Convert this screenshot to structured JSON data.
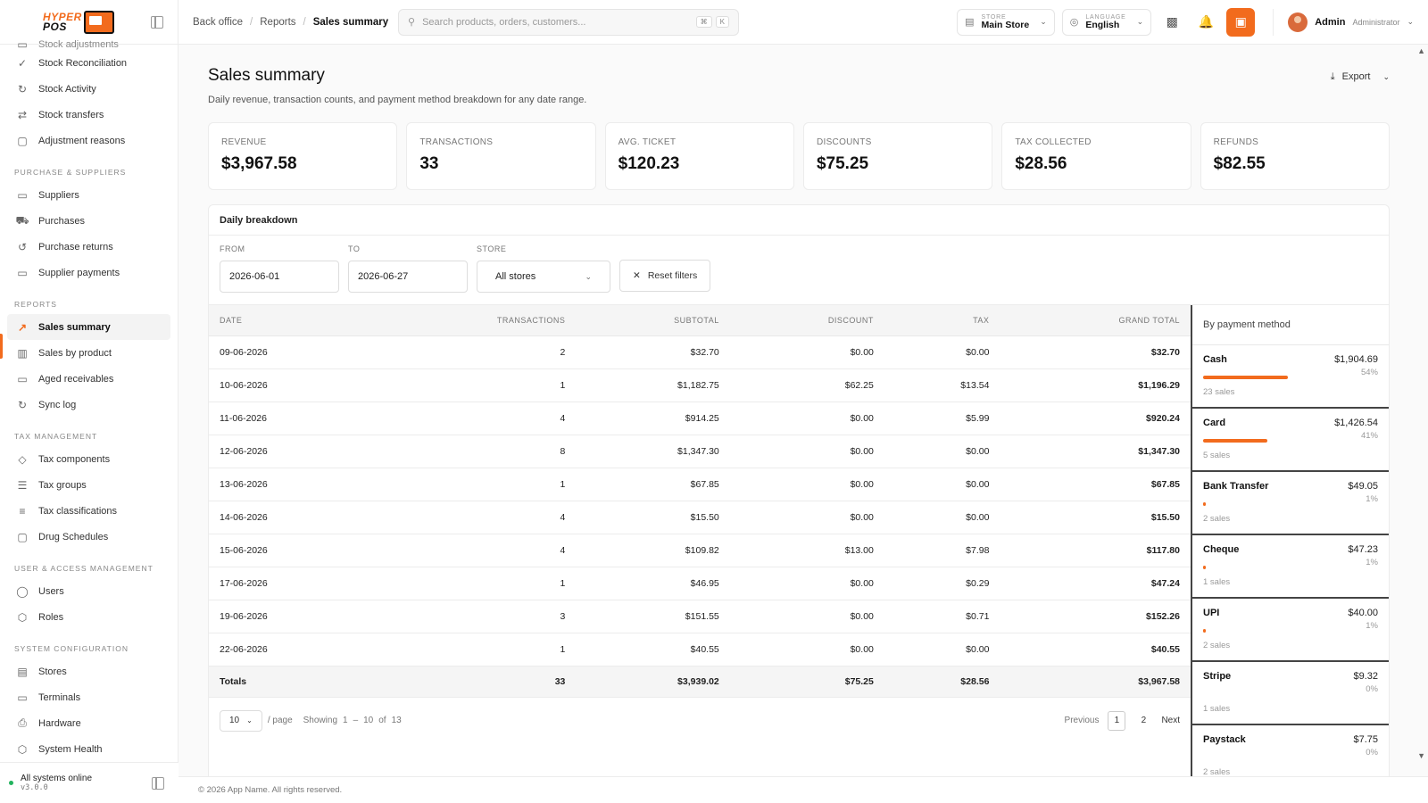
{
  "brand": {
    "line1": "HYPER",
    "line2": "POS"
  },
  "sidebar": {
    "partial_item": "Stock adjustments",
    "items_top": [
      {
        "label": "Stock Reconciliation",
        "icon": "check-icon"
      },
      {
        "label": "Stock Activity",
        "icon": "refresh-icon"
      },
      {
        "label": "Stock transfers",
        "icon": "transfer-icon"
      },
      {
        "label": "Adjustment reasons",
        "icon": "note-icon"
      }
    ],
    "sections": [
      {
        "title": "PURCHASE & SUPPLIERS",
        "items": [
          "Suppliers",
          "Purchases",
          "Purchase returns",
          "Supplier payments"
        ]
      },
      {
        "title": "REPORTS",
        "items": [
          "Sales summary",
          "Sales by product",
          "Aged receivables",
          "Sync log"
        ]
      },
      {
        "title": "TAX MANAGEMENT",
        "items": [
          "Tax components",
          "Tax groups",
          "Tax classifications",
          "Drug Schedules"
        ]
      },
      {
        "title": "USER & ACCESS MANAGEMENT",
        "items": [
          "Users",
          "Roles"
        ]
      },
      {
        "title": "SYSTEM CONFIGURATION",
        "items": [
          "Stores",
          "Terminals",
          "Hardware",
          "System Health"
        ]
      }
    ],
    "status_text": "All systems online",
    "version": "v3.0.0"
  },
  "breadcrumb": {
    "items": [
      "Back office",
      "Reports"
    ],
    "current": "Sales summary"
  },
  "search": {
    "placeholder": "Search products, orders, customers...",
    "kbd1": "⌘",
    "kbd2": "K"
  },
  "store_select": {
    "label": "STORE",
    "value": "Main Store"
  },
  "language_select": {
    "label": "LANGUAGE",
    "value": "English"
  },
  "user": {
    "name": "Admin",
    "role": "Administrator"
  },
  "page": {
    "title": "Sales summary",
    "subtitle": "Daily revenue, transaction counts, and payment method breakdown for any date range.",
    "export_label": "Export"
  },
  "stats": [
    {
      "label": "REVENUE",
      "value": "$3,967.58"
    },
    {
      "label": "TRANSACTIONS",
      "value": "33"
    },
    {
      "label": "AVG. TICKET",
      "value": "$120.23"
    },
    {
      "label": "DISCOUNTS",
      "value": "$75.25"
    },
    {
      "label": "TAX COLLECTED",
      "value": "$28.56"
    },
    {
      "label": "REFUNDS",
      "value": "$82.55"
    }
  ],
  "breakdown": {
    "title": "Daily breakdown",
    "filters": {
      "from_label": "FROM",
      "from_value": "2026-06-01",
      "to_label": "TO",
      "to_value": "2026-06-27",
      "store_label": "STORE",
      "store_value": "All stores",
      "reset_label": "Reset filters"
    },
    "columns": [
      "DATE",
      "TRANSACTIONS",
      "SUBTOTAL",
      "DISCOUNT",
      "TAX",
      "GRAND TOTAL"
    ],
    "rows": [
      [
        "09-06-2026",
        "2",
        "$32.70",
        "$0.00",
        "$0.00",
        "$32.70"
      ],
      [
        "10-06-2026",
        "1",
        "$1,182.75",
        "$62.25",
        "$13.54",
        "$1,196.29"
      ],
      [
        "11-06-2026",
        "4",
        "$914.25",
        "$0.00",
        "$5.99",
        "$920.24"
      ],
      [
        "12-06-2026",
        "8",
        "$1,347.30",
        "$0.00",
        "$0.00",
        "$1,347.30"
      ],
      [
        "13-06-2026",
        "1",
        "$67.85",
        "$0.00",
        "$0.00",
        "$67.85"
      ],
      [
        "14-06-2026",
        "4",
        "$15.50",
        "$0.00",
        "$0.00",
        "$15.50"
      ],
      [
        "15-06-2026",
        "4",
        "$109.82",
        "$13.00",
        "$7.98",
        "$117.80"
      ],
      [
        "17-06-2026",
        "1",
        "$46.95",
        "$0.00",
        "$0.29",
        "$47.24"
      ],
      [
        "19-06-2026",
        "3",
        "$151.55",
        "$0.00",
        "$0.71",
        "$152.26"
      ],
      [
        "22-06-2026",
        "1",
        "$40.55",
        "$0.00",
        "$0.00",
        "$40.55"
      ]
    ],
    "totals": [
      "Totals",
      "33",
      "$3,939.02",
      "$75.25",
      "$28.56",
      "$3,967.58"
    ],
    "pager": {
      "page_size": "10",
      "per_page": "/ page",
      "showing": "Showing",
      "from": "1",
      "dash": "–",
      "to": "10",
      "of": "of",
      "total": "13",
      "previous": "Previous",
      "pages": [
        "1",
        "2"
      ],
      "next": "Next"
    }
  },
  "payments": {
    "title": "By payment method",
    "items": [
      {
        "name": "Cash",
        "amount": "$1,904.69",
        "percent": "54%",
        "share": 0.54,
        "count": "23 sales"
      },
      {
        "name": "Card",
        "amount": "$1,426.54",
        "percent": "41%",
        "share": 0.41,
        "count": "5 sales"
      },
      {
        "name": "Bank Transfer",
        "amount": "$49.05",
        "percent": "1%",
        "share": 0.01,
        "count": "2 sales"
      },
      {
        "name": "Cheque",
        "amount": "$47.23",
        "percent": "1%",
        "share": 0.01,
        "count": "1 sales"
      },
      {
        "name": "UPI",
        "amount": "$40.00",
        "percent": "1%",
        "share": 0.01,
        "count": "2 sales"
      },
      {
        "name": "Stripe",
        "amount": "$9.32",
        "percent": "0%",
        "share": 0,
        "count": "1 sales"
      },
      {
        "name": "Paystack",
        "amount": "$7.75",
        "percent": "0%",
        "share": 0,
        "count": "2 sales"
      }
    ]
  },
  "footer": {
    "text": "© 2026 App Name. All rights reserved."
  },
  "colors": {
    "accent": "#f26b1d",
    "status": "#22b35e"
  }
}
